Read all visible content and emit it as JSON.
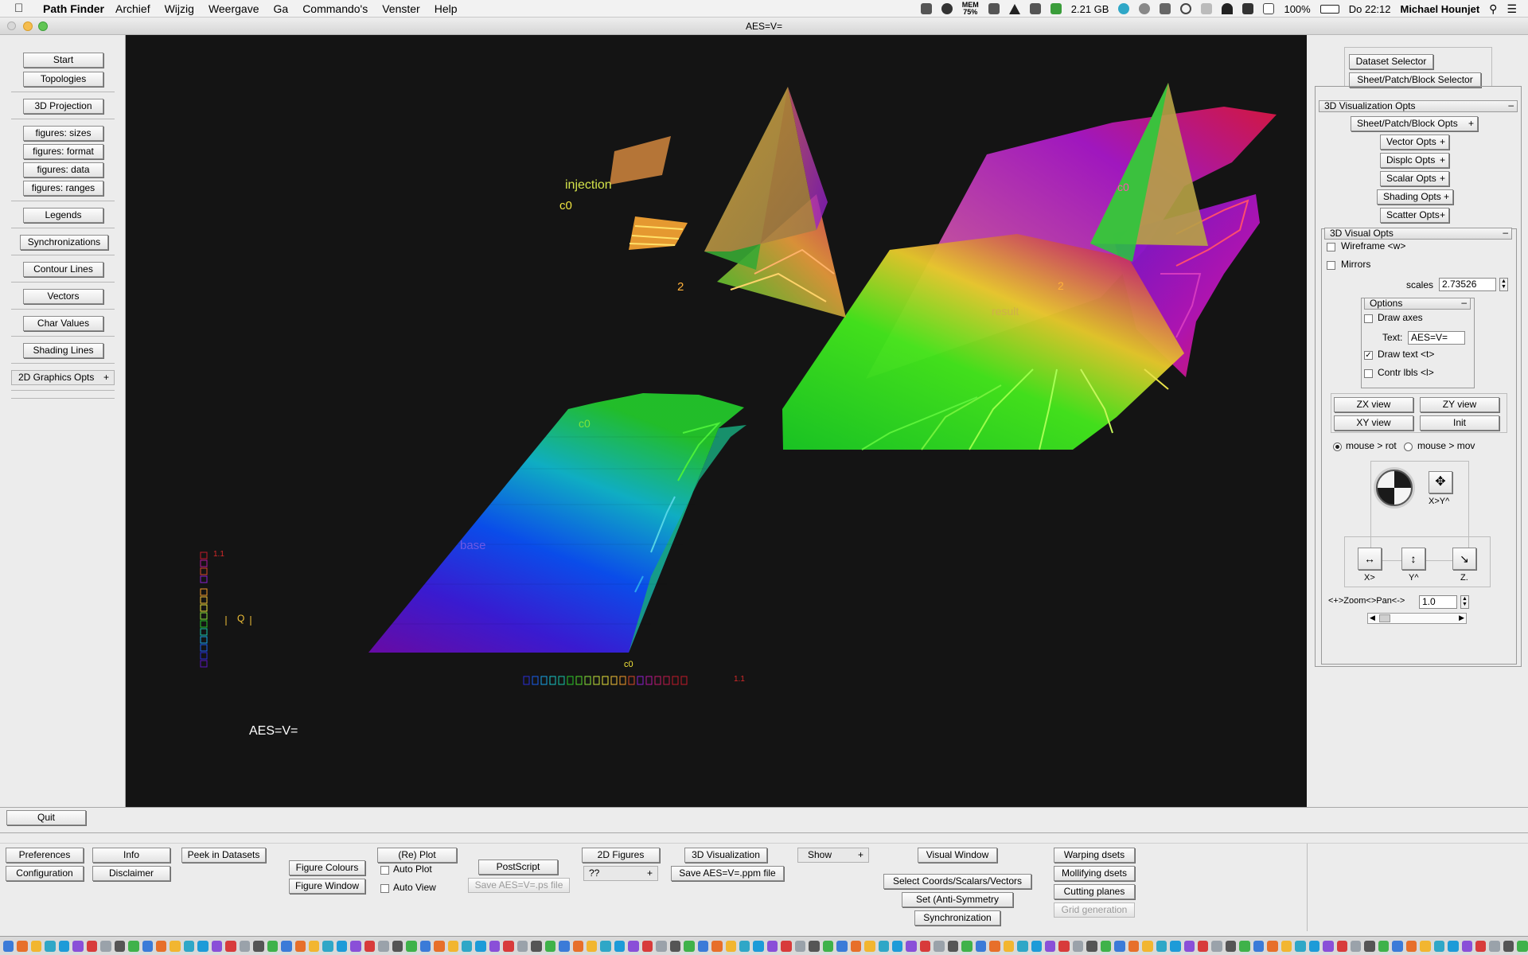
{
  "menubar": {
    "app_name": "Path Finder",
    "menus": [
      "Archief",
      "Wijzig",
      "Weergave",
      "Ga",
      "Commando's",
      "Venster",
      "Help"
    ],
    "memory": "2.21 GB",
    "mem_label": "MEM",
    "mem_percent": "75%",
    "battery": "100%",
    "clock": "Do 22:12",
    "user": "Michael Hounjet"
  },
  "window": {
    "title": "AES=V="
  },
  "left_panel": {
    "start": "Start",
    "topologies": "Topologies",
    "projection": "3D Projection",
    "fig_sizes": "figures: sizes",
    "fig_format": "figures: format",
    "fig_data": "figures: data",
    "fig_ranges": "figures: ranges",
    "legends": "Legends",
    "synchronizations": "Synchronizations",
    "contour_lines": "Contour Lines",
    "vectors": "Vectors",
    "char_values": "Char Values",
    "shading_lines": "Shading Lines",
    "graphics_opts": "2D Graphics Opts",
    "quit": "Quit"
  },
  "canvas": {
    "label_injection": "injection",
    "label_c0": "c0",
    "label_2": "2",
    "label_result": "result",
    "label_base": "base",
    "label_1_1": "1.1",
    "label_q": "Q",
    "label_title": "AES=V="
  },
  "right_panel": {
    "dataset_selector": "Dataset Selector",
    "sheet_selector": "Sheet/Patch/Block Selector",
    "viz_opts_header": "3D Visualization Opts",
    "sheet_opts": "Sheet/Patch/Block Opts",
    "vector_opts": "Vector  Opts",
    "displ_opts": "Displc  Opts",
    "scalar_opts": "Scalar  Opts",
    "shading_opts": "Shading  Opts",
    "scatter_opts": "Scatter Opts",
    "visual_opts_header": "3D Visual Opts",
    "wireframe": "Wireframe <w>",
    "mirrors": "Mirrors",
    "scales_label": "scales",
    "scales_value": "2.73526",
    "options_header": "Options",
    "draw_axes": "Draw axes",
    "text_label": "Text:",
    "text_value": "AES=V=",
    "draw_text": "Draw  text <t>",
    "contr_lbls": "Contr lbls <l>",
    "zx_view": "ZX view",
    "zy_view": "ZY view",
    "xy_view": "XY view",
    "init": "Init",
    "mouse_rot": "mouse >  rot",
    "mouse_mov": "mouse >  mov",
    "xy_label": "X>Y^",
    "x_label": "X>",
    "y_label": "Y^",
    "z_label": "Z.",
    "zoom_label": "<+>Zoom<>Pan<->",
    "zoom_value": "1.0"
  },
  "bottom_panel": {
    "preferences": "Preferences",
    "configuration": "Configuration",
    "info": "Info",
    "disclaimer": "Disclaimer",
    "peek": "Peek in Datasets",
    "figure_colours": "Figure Colours",
    "figure_window": "Figure Window",
    "replot": "(Re) Plot",
    "auto_plot": "Auto Plot",
    "auto_view": "Auto View",
    "postscript": "PostScript",
    "save_ps": "Save AES=V=.ps file",
    "figures_2d": "2D Figures",
    "qq": "??",
    "viz_3d": "3D Visualization",
    "save_ppm": "Save AES=V=.ppm file",
    "show": "Show",
    "visual_window": "Visual Window",
    "select_coords": "Select Coords/Scalars/Vectors",
    "set_symmetry": "Set    (Anti-Symmetry",
    "synchronization": "Synchronization",
    "warping": "Warping    dsets",
    "mollifying": "Mollifying dsets",
    "cutting": "Cutting planes",
    "grid_gen": "Grid generation"
  }
}
